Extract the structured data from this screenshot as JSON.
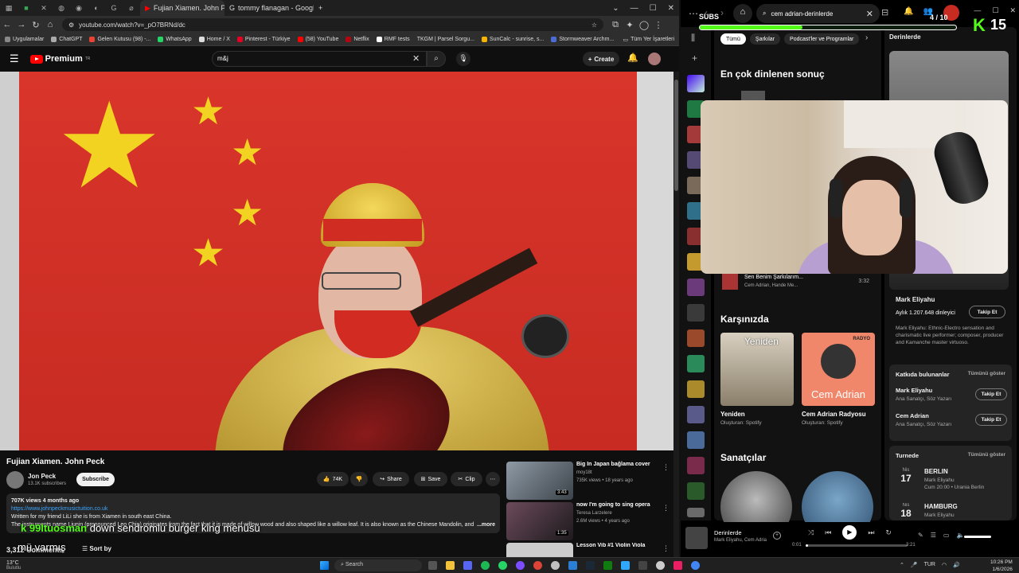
{
  "chrome": {
    "tabs": [
      {
        "label": "Fujian Xiamen. John Peck",
        "active": true
      },
      {
        "label": "tommy flanagan - Google'da A",
        "active": false
      }
    ],
    "url": "youtube.com/watch?v=_pO7BRNd/dc",
    "bookmarks": [
      "Uygulamalar",
      "ChatGPT",
      "Gelen Kutusu (98) -...",
      "WhatsApp",
      "Home / X",
      "Pinterest - Türkiye",
      "(58) YouTube",
      "Netflix",
      "RMF tests",
      "TKGM | Parsel Sorgu...",
      "SunCalc - sunrise, s...",
      "Stormweaver Archm..."
    ],
    "bookmarks_right": "Tüm Yer İşaretleri"
  },
  "youtube": {
    "brand": "Premium",
    "region": "TR",
    "search_value": "m&j",
    "create_label": "Create",
    "video_title": "Fujian Xiamen. John Peck",
    "channel": "Jon Peck",
    "subscribers": "13.1K subscribers",
    "subscribe_label": "Subscribe",
    "likes": "74K",
    "share_label": "Share",
    "save_label": "Save",
    "clip_label": "Clip",
    "description": {
      "stats": "707K views  4 months ago",
      "link": "https://www.johnpeckmusictuition.co.uk",
      "line1": "Written for my friend LiLi she is from Xiamen in south east China.",
      "line2": "The instruments name Liunin (pronounced Leo Chin) originates from the fact that it is made of willow wood and also shaped like a willow leaf. It is also known as the Chinese Mandolin, and",
      "more": "...more"
    },
    "comments_count": "3,312 Comments",
    "sort_label": "Sort by",
    "recommendations": [
      {
        "title": "Big In Japan bağlama cover",
        "channel": "moy18t",
        "views": "735K views • 18 years ago",
        "duration": "3:43"
      },
      {
        "title": "now I'm going to sing opera",
        "channel": "Teresa Larzelere",
        "views": "2.6M views • 4 years ago",
        "duration": "1:35"
      },
      {
        "title": "Lesson   Vib #1 Violin Viola",
        "channel": "",
        "views": "",
        "duration": ""
      }
    ]
  },
  "overlay": {
    "chat_user": "k 99ltuosman",
    "chat_text": "down sendromlu burger king menüsü",
    "chat_text2": "mü varmış",
    "subs_label": "SUBS",
    "subs_count": "4 / 10",
    "subs_progress": 0.4,
    "kick_number": "15",
    "kick_letter": "K"
  },
  "spotify": {
    "search_value": "cem adrian-derinlerde",
    "chips": [
      "Tümü",
      "Şarkılar",
      "Podcast'ler ve Programlar"
    ],
    "top_result_heading": "En çok dinlenen sonuç",
    "song": {
      "title": "Sen Benim Şarkılarım...",
      "artists": "Cem Adrian, Hande Me...",
      "duration": "3:32"
    },
    "featuring_heading": "Karşınızda",
    "cards": [
      {
        "title": "Yeniden",
        "subtitle": "Oluşturan: Spotify",
        "img_text": "Yeniden"
      },
      {
        "title": "Cem Adrian Radyosu",
        "subtitle": "Oluşturan: Spotify",
        "img_text": "Cem Adrian",
        "badge": "RADYO"
      }
    ],
    "artists_heading": "Sanatçılar",
    "right_title": "Derinlerde",
    "artist": {
      "name": "Mark Eliyahu",
      "listeners": "Aylık 1.207.648 dinleyici",
      "follow_label": "Takip Et",
      "bio": "Mark Eliyahu: Ethnic-Electro sensation and charismatic live performer; composer, producer and Kamanche master virtuoso."
    },
    "credits_heading": "Katkıda bulunanlar",
    "show_all": "Tümünü göster",
    "credits": [
      {
        "name": "Mark Eliyahu",
        "role": "Ana Sanatçı, Söz Yazarı",
        "follow": "Takip Et"
      },
      {
        "name": "Cem Adrian",
        "role": "Ana Sanatçı, Söz Yazarı",
        "follow": "Takip Et"
      }
    ],
    "tour_heading": "Turnede",
    "tours": [
      {
        "month": "Nis",
        "day": "17",
        "city": "BERLIN",
        "artist": "Mark Eliyahu",
        "venue": "Cum 20:00 • Urania Berlin"
      },
      {
        "month": "Nis",
        "day": "18",
        "city": "HAMBURG",
        "artist": "Mark Eliyahu",
        "venue": ""
      }
    ],
    "player": {
      "title": "Derinlerde",
      "artists": "Mark Eliyahu, Cem Adria",
      "current": "0:01",
      "total": "3:21",
      "progress": 0.01
    }
  },
  "taskbar": {
    "temp": "13°C",
    "weather": "Bulutlu",
    "search": "Search",
    "lang": "TUR",
    "time": "10:26 PM",
    "date": "1/6/2026"
  }
}
